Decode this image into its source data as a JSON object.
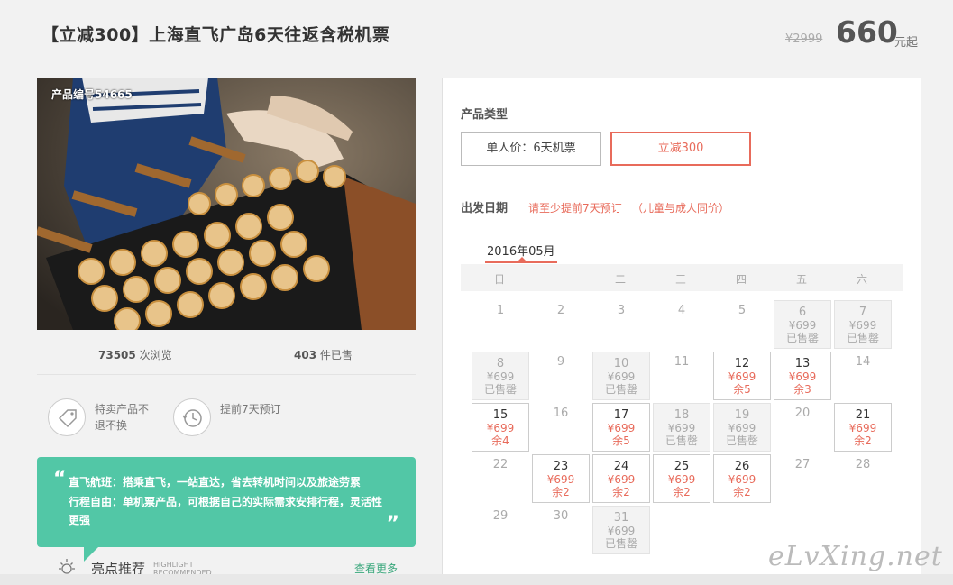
{
  "header": {
    "title": "【立减300】上海直飞广岛6天往返含税机票",
    "price_old": "¥2999",
    "price_now": "660",
    "price_unit": "元起"
  },
  "product": {
    "code": "产品编号54665",
    "views_num": "73505",
    "views_label": "次浏览",
    "sold_num": "403",
    "sold_label": "件已售"
  },
  "features": [
    {
      "icon": "tag-icon",
      "text": "特卖产品不退不换"
    },
    {
      "icon": "clock-history-icon",
      "text": "提前7天预订"
    }
  ],
  "quote": {
    "line1": "直飞航班：搭乘直飞，一站直达，省去转机时间以及旅途劳累",
    "line2": "行程自由：单机票产品，可根据自己的实际需求安排行程，灵活性",
    "line3": "更强"
  },
  "highlight": {
    "title": "亮点推荐",
    "sub1": "HIGHLIGHT",
    "sub2": "RECOMMENDED",
    "more": "查看更多"
  },
  "booking": {
    "type_label": "产品类型",
    "options": [
      "单人价：6天机票",
      "立减300"
    ],
    "selected_option": 1,
    "date_label": "出发日期",
    "tip1": "请至少提前7天预订",
    "tip2": "（儿童与成人同价）",
    "month": "2016年05月",
    "weekdays": [
      "日",
      "一",
      "二",
      "三",
      "四",
      "五",
      "六"
    ]
  },
  "calendar": {
    "days": [
      {
        "d": "1",
        "state": "plain",
        "price": "",
        "status": ""
      },
      {
        "d": "2",
        "state": "plain",
        "price": "",
        "status": ""
      },
      {
        "d": "3",
        "state": "plain",
        "price": "",
        "status": ""
      },
      {
        "d": "4",
        "state": "plain",
        "price": "",
        "status": ""
      },
      {
        "d": "5",
        "state": "plain",
        "price": "",
        "status": ""
      },
      {
        "d": "6",
        "state": "sold",
        "price": "¥699",
        "status": "已售罄"
      },
      {
        "d": "7",
        "state": "sold",
        "price": "¥699",
        "status": "已售罄"
      },
      {
        "d": "8",
        "state": "sold",
        "price": "¥699",
        "status": "已售罄"
      },
      {
        "d": "9",
        "state": "plain",
        "price": "",
        "status": ""
      },
      {
        "d": "10",
        "state": "sold",
        "price": "¥699",
        "status": "已售罄"
      },
      {
        "d": "11",
        "state": "plain",
        "price": "",
        "status": ""
      },
      {
        "d": "12",
        "state": "avail",
        "price": "¥699",
        "status": "余5"
      },
      {
        "d": "13",
        "state": "avail",
        "price": "¥699",
        "status": "余3"
      },
      {
        "d": "14",
        "state": "plain",
        "price": "",
        "status": ""
      },
      {
        "d": "15",
        "state": "avail",
        "price": "¥699",
        "status": "余4"
      },
      {
        "d": "16",
        "state": "plain",
        "price": "",
        "status": ""
      },
      {
        "d": "17",
        "state": "avail",
        "price": "¥699",
        "status": "余5"
      },
      {
        "d": "18",
        "state": "sold",
        "price": "¥699",
        "status": "已售罄"
      },
      {
        "d": "19",
        "state": "sold",
        "price": "¥699",
        "status": "已售罄"
      },
      {
        "d": "20",
        "state": "plain",
        "price": "",
        "status": ""
      },
      {
        "d": "21",
        "state": "avail",
        "price": "¥699",
        "status": "余2"
      },
      {
        "d": "22",
        "state": "plain",
        "price": "",
        "status": ""
      },
      {
        "d": "23",
        "state": "avail",
        "price": "¥699",
        "status": "余2"
      },
      {
        "d": "24",
        "state": "avail",
        "price": "¥699",
        "status": "余2"
      },
      {
        "d": "25",
        "state": "avail",
        "price": "¥699",
        "status": "余2"
      },
      {
        "d": "26",
        "state": "avail",
        "price": "¥699",
        "status": "余2"
      },
      {
        "d": "27",
        "state": "plain",
        "price": "",
        "status": ""
      },
      {
        "d": "28",
        "state": "plain",
        "price": "",
        "status": ""
      },
      {
        "d": "29",
        "state": "plain",
        "price": "",
        "status": ""
      },
      {
        "d": "30",
        "state": "plain",
        "price": "",
        "status": ""
      },
      {
        "d": "31",
        "state": "sold",
        "price": "¥699",
        "status": "已售罄"
      }
    ]
  },
  "watermark": "eLvXing.net",
  "colors": {
    "accent": "#e86b5b",
    "teal": "#52c7a6"
  }
}
